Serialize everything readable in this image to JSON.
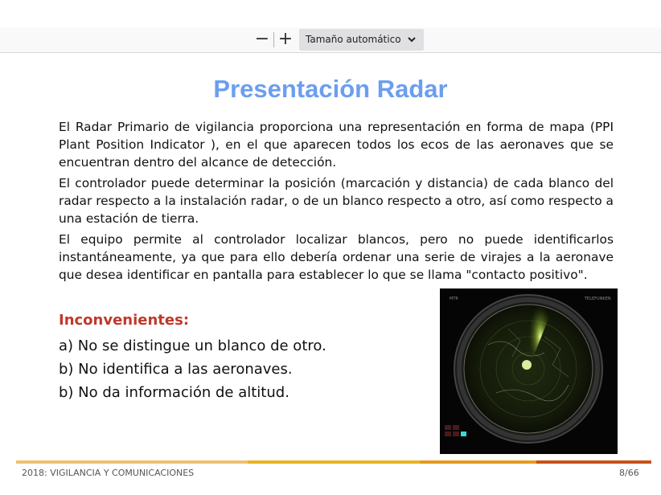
{
  "toolbar": {
    "zoom_out_icon": "minus-icon",
    "zoom_in_icon": "plus-icon",
    "zoom_select": "Tamaño automático",
    "zoom_chevron_icon": "chevron-down-icon"
  },
  "slide": {
    "title": "Presentación Radar",
    "paragraphs": [
      "El Radar Primario de vigilancia proporciona una representación en forma de mapa (PPI Plant Position Indicator ), en el que aparecen todos los ecos de las aeronaves que se encuentran dentro del alcance de detección.",
      "El controlador puede determinar la posición (marcación y distancia) de cada blanco del radar respecto a la instalación radar, o de un blanco respecto a otro, así como respecto a una estación de tierra.",
      "El equipo permite al controlador localizar blancos, pero no puede identificarlos instantáneamente,  ya que para ello debería ordenar una serie de virajes a la aeronave que desea identificar en pantalla para establecer lo que se llama \"contacto positivo\"."
    ],
    "inconvenientes_title": "Inconvenientes:",
    "inconvenientes": [
      "a) No se distingue un blanco de otro.",
      "b) No identifica a las aeronaves.",
      "b) No da información de altitud."
    ],
    "radar_image": {
      "label_left": "MTR",
      "label_right": "TELEFUNKEN"
    }
  },
  "footer": {
    "left": "2018: VIGILANCIA Y COMUNICACIONES",
    "page": "8/66"
  },
  "colors": {
    "title": "#6b9ef0",
    "inconvenientes": "#c0392b",
    "bar_segments": [
      "#f0c070",
      "#e8b422",
      "#e59a1e",
      "#c8521a"
    ]
  }
}
